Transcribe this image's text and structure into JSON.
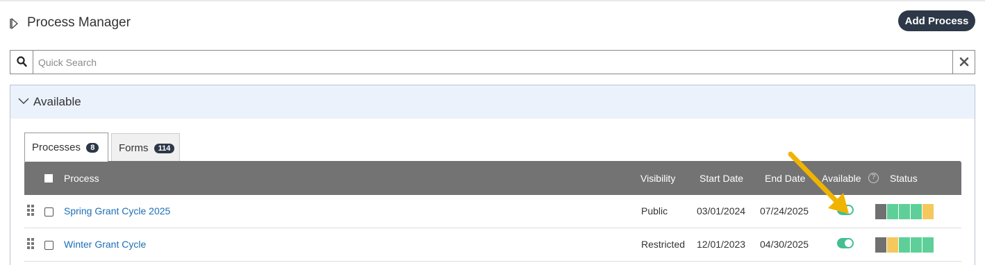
{
  "header": {
    "title": "Process Manager",
    "add_button": "Add Process"
  },
  "search": {
    "placeholder": "Quick Search",
    "value": ""
  },
  "panel": {
    "title": "Available"
  },
  "tabs": [
    {
      "label": "Processes",
      "count": "8",
      "active": true
    },
    {
      "label": "Forms",
      "count": "114",
      "active": false
    }
  ],
  "table": {
    "columns": {
      "process": "Process",
      "visibility": "Visibility",
      "start_date": "Start Date",
      "end_date": "End Date",
      "available": "Available",
      "status": "Status"
    },
    "rows": [
      {
        "process": "Spring Grant Cycle 2025",
        "visibility": "Public",
        "start_date": "03/01/2024",
        "end_date": "07/24/2025",
        "available": true,
        "status": [
          "#707070",
          "#5ecf98",
          "#5ecf98",
          "#5ecf98",
          "#f4c85c"
        ]
      },
      {
        "process": "Winter Grant Cycle",
        "visibility": "Restricted",
        "start_date": "12/01/2023",
        "end_date": "04/30/2025",
        "available": true,
        "status": [
          "#707070",
          "#f4c85c",
          "#5ecf98",
          "#5ecf98",
          "#5ecf98"
        ]
      }
    ]
  },
  "colors": {
    "accent_dark": "#2d3848",
    "toggle_on": "#43bf90",
    "link": "#1a6fb5",
    "header_bg": "#737373",
    "annotation_arrow": "#f0b400"
  },
  "icons": [
    "expand-panel-icon",
    "search-icon",
    "clear-icon",
    "chevron-down-icon",
    "help-icon",
    "drag-handle-icon",
    "arrow-annotation-icon"
  ]
}
